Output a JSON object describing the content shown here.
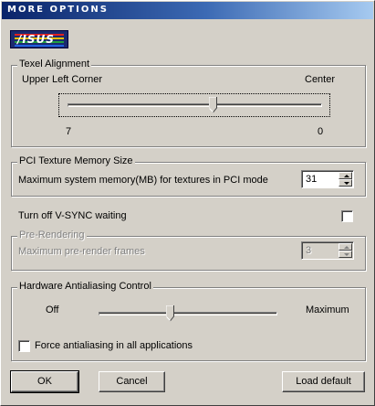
{
  "window": {
    "title": "MORE OPTIONS"
  },
  "logo": {
    "text": "/ISUS"
  },
  "texel_alignment": {
    "title": "Texel Alignment",
    "left_label": "Upper Left Corner",
    "right_label": "Center",
    "left_value": "7",
    "right_value": "0",
    "slider_position_fraction": 0.57
  },
  "pci_texture": {
    "title": "PCI Texture Memory Size",
    "label": "Maximum system memory(MB) for textures in PCI mode",
    "value": "31"
  },
  "vsync": {
    "label": "Turn off V-SYNC waiting",
    "checked": false
  },
  "pre_rendering": {
    "title": "Pre-Rendering",
    "label": "Maximum pre-render frames",
    "value": "3",
    "enabled": false
  },
  "antialiasing": {
    "title": "Hardware Antialiasing Control",
    "left_label": "Off",
    "right_label": "Maximum",
    "slider_position_fraction": 0.4,
    "force_label": "Force antialiasing in all applications",
    "force_checked": false
  },
  "buttons": {
    "ok": "OK",
    "cancel": "Cancel",
    "load_default": "Load default"
  },
  "colors": {
    "face": "#d4d0c8",
    "title_start": "#0a246a",
    "title_end": "#a6caf0",
    "disabled_text": "#808080"
  }
}
